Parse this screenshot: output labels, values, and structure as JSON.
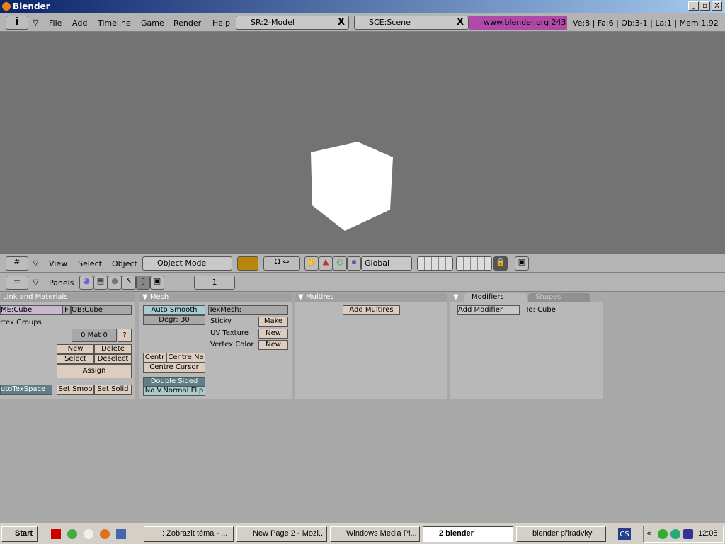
{
  "window": {
    "title": "Blender"
  },
  "info_header": {
    "menus": [
      "File",
      "Add",
      "Timeline",
      "Game",
      "Render",
      "Help"
    ],
    "screen": "SR:2-Model",
    "scene": "SCE:Scene",
    "banner": "www.blender.org 243",
    "stats": "Ve:8 | Fa:6 | Ob:3-1 | La:1  | Mem:1.92"
  },
  "view3d_header": {
    "menus": [
      "View",
      "Select",
      "Object"
    ],
    "mode": "Object Mode",
    "orientation": "Global"
  },
  "buttons_header": {
    "panels_label": "Panels",
    "frame": "1"
  },
  "link_materials": {
    "title": "Link and Materials",
    "mesh_name": "ME:Cube",
    "f": "F",
    "object_name": "OB:Cube",
    "vertex_groups": "rtex Groups",
    "mat": "0 Mat 0",
    "help": "?",
    "new": "New",
    "delete": "Delete",
    "select": "Select",
    "deselect": "Deselect",
    "assign": "Assign",
    "autotex": "utoTexSpace",
    "set_smooth": "Set Smoo",
    "set_solid": "Set Solid"
  },
  "mesh": {
    "title": "Mesh",
    "auto_smooth": "Auto Smooth",
    "degr": "Degr: 30",
    "texmesh": "TexMesh:",
    "sticky": "Sticky",
    "make": "Make",
    "uv_texture": "UV Texture",
    "uv_new": "New",
    "vertex_color": "Vertex Color",
    "vc_new": "New",
    "centre": "Centr",
    "centre_new": "Centre Ne",
    "centre_cursor": "Centre Cursor",
    "double_sided": "Double Sided",
    "no_vnormal_flip": "No V.Normal Flip"
  },
  "multires": {
    "title": "Multires",
    "add": "Add Multires"
  },
  "modifiers": {
    "tab_modifiers": "Modifiers",
    "tab_shapes": "Shapes",
    "add": "Add Modifier",
    "to": "To: Cube"
  },
  "taskbar": {
    "start": "Start",
    "tasks": [
      ":: Zobrazit téma - ...",
      "New Page 2 - Mozi...",
      "Windows Media Pl...",
      "2 blender",
      "blender přiradvky"
    ],
    "lang": "CS",
    "clock": "12:05"
  },
  "colors": {
    "viewport": "#737373",
    "banner": "#b04aa8",
    "button": "#dccdbf",
    "toggle_on": "#5f7f87"
  }
}
